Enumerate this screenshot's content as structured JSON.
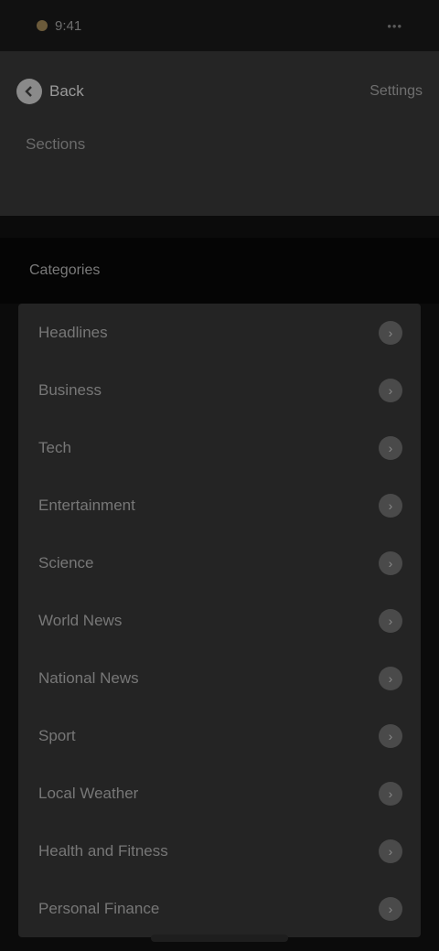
{
  "status": {
    "time": "9:41",
    "signal": "•••"
  },
  "header": {
    "back_label": "Back",
    "action_label": "Settings",
    "title": "Sections"
  },
  "section": {
    "title": "Categories"
  },
  "items": [
    {
      "label": "Headlines",
      "icon": "›"
    },
    {
      "label": "Business",
      "icon": "›"
    },
    {
      "label": "Tech",
      "icon": "›"
    },
    {
      "label": "Entertainment",
      "icon": "›"
    },
    {
      "label": "Science",
      "icon": "›"
    },
    {
      "label": "World News",
      "icon": "›"
    },
    {
      "label": "National News",
      "icon": "›"
    },
    {
      "label": "Sport",
      "icon": "›"
    },
    {
      "label": "Local Weather",
      "icon": "›"
    },
    {
      "label": "Health and Fitness",
      "icon": "›"
    },
    {
      "label": "Personal Finance",
      "icon": "›"
    }
  ]
}
